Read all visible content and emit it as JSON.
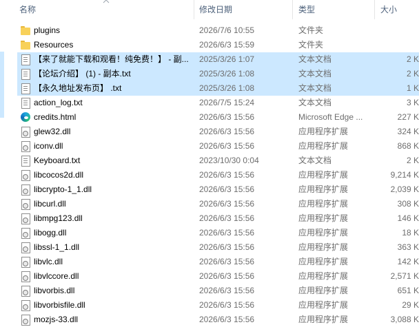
{
  "columns": {
    "name": "名称",
    "date": "修改日期",
    "type": "类型",
    "size": "大小"
  },
  "files": [
    {
      "name": "plugins",
      "date": "2026/7/6 10:55",
      "type": "文件夹",
      "size": "",
      "icon": "folder-icon",
      "selected": false
    },
    {
      "name": "Resources",
      "date": "2026/6/3 15:59",
      "type": "文件夹",
      "size": "",
      "icon": "folder-icon",
      "selected": false
    },
    {
      "name": "【来了就能下载和观看！纯免费！】 - 副...",
      "date": "2025/3/26 1:07",
      "type": "文本文档",
      "size": "2 K",
      "icon": "text-file-icon",
      "selected": true
    },
    {
      "name": "【论坛介绍】 (1) - 副本.txt",
      "date": "2025/3/26 1:08",
      "type": "文本文档",
      "size": "2 K",
      "icon": "text-file-icon",
      "selected": true
    },
    {
      "name": "【永久地址发布页】 .txt",
      "date": "2025/3/26 1:08",
      "type": "文本文档",
      "size": "1 K",
      "icon": "text-file-icon",
      "selected": true
    },
    {
      "name": "action_log.txt",
      "date": "2026/7/5 15:24",
      "type": "文本文档",
      "size": "3 K",
      "icon": "text-file-icon",
      "selected": false
    },
    {
      "name": "credits.html",
      "date": "2026/6/3 15:56",
      "type": "Microsoft Edge ...",
      "size": "227 K",
      "icon": "edge-icon",
      "selected": false
    },
    {
      "name": "glew32.dll",
      "date": "2026/6/3 15:56",
      "type": "应用程序扩展",
      "size": "324 K",
      "icon": "dll-icon",
      "selected": false
    },
    {
      "name": "iconv.dll",
      "date": "2026/6/3 15:56",
      "type": "应用程序扩展",
      "size": "868 K",
      "icon": "dll-icon",
      "selected": false
    },
    {
      "name": "Keyboard.txt",
      "date": "2023/10/30 0:04",
      "type": "文本文档",
      "size": "2 K",
      "icon": "text-file-icon",
      "selected": false
    },
    {
      "name": "libcocos2d.dll",
      "date": "2026/6/3 15:56",
      "type": "应用程序扩展",
      "size": "9,214 K",
      "icon": "dll-icon",
      "selected": false
    },
    {
      "name": "libcrypto-1_1.dll",
      "date": "2026/6/3 15:56",
      "type": "应用程序扩展",
      "size": "2,039 K",
      "icon": "dll-icon",
      "selected": false
    },
    {
      "name": "libcurl.dll",
      "date": "2026/6/3 15:56",
      "type": "应用程序扩展",
      "size": "308 K",
      "icon": "dll-icon",
      "selected": false
    },
    {
      "name": "libmpg123.dll",
      "date": "2026/6/3 15:56",
      "type": "应用程序扩展",
      "size": "146 K",
      "icon": "dll-icon",
      "selected": false
    },
    {
      "name": "libogg.dll",
      "date": "2026/6/3 15:56",
      "type": "应用程序扩展",
      "size": "18 K",
      "icon": "dll-icon",
      "selected": false
    },
    {
      "name": "libssl-1_1.dll",
      "date": "2026/6/3 15:56",
      "type": "应用程序扩展",
      "size": "363 K",
      "icon": "dll-icon",
      "selected": false
    },
    {
      "name": "libvlc.dll",
      "date": "2026/6/3 15:56",
      "type": "应用程序扩展",
      "size": "142 K",
      "icon": "dll-icon",
      "selected": false
    },
    {
      "name": "libvlccore.dll",
      "date": "2026/6/3 15:56",
      "type": "应用程序扩展",
      "size": "2,571 K",
      "icon": "dll-icon",
      "selected": false
    },
    {
      "name": "libvorbis.dll",
      "date": "2026/6/3 15:56",
      "type": "应用程序扩展",
      "size": "651 K",
      "icon": "dll-icon",
      "selected": false
    },
    {
      "name": "libvorbisfile.dll",
      "date": "2026/6/3 15:56",
      "type": "应用程序扩展",
      "size": "29 K",
      "icon": "dll-icon",
      "selected": false
    },
    {
      "name": "mozjs-33.dll",
      "date": "2026/6/3 15:56",
      "type": "应用程序扩展",
      "size": "3,088 K",
      "icon": "dll-icon",
      "selected": false
    }
  ]
}
